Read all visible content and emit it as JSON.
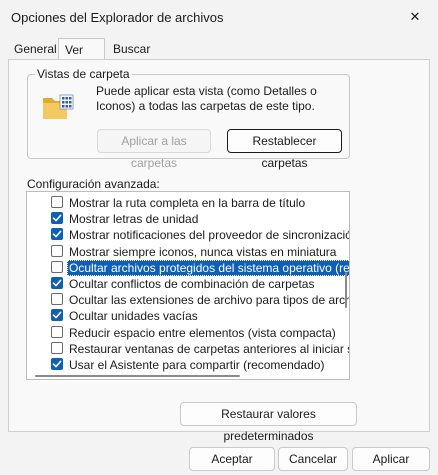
{
  "window": {
    "title": "Opciones del Explorador de archivos",
    "close_glyph": "✕"
  },
  "tabs": [
    {
      "label": "General",
      "active": false
    },
    {
      "label": "Ver",
      "active": true
    },
    {
      "label": "Buscar",
      "active": false
    }
  ],
  "folder_views": {
    "group_label": "Vistas de carpeta",
    "description": "Puede aplicar esta vista (como Detalles o Iconos) a todas las carpetas de este tipo.",
    "apply_label": "Aplicar a las carpetas",
    "reset_label": "Restablecer carpetas"
  },
  "advanced": {
    "label": "Configuración avanzada:",
    "items": [
      {
        "label": "Mostrar la ruta completa en la barra de título",
        "checked": false
      },
      {
        "label": "Mostrar letras de unidad",
        "checked": true
      },
      {
        "label": "Mostrar notificaciones del proveedor de sincronización",
        "checked": true
      },
      {
        "label": "Mostrar siempre iconos, nunca vistas en miniatura",
        "checked": false
      },
      {
        "label": "Ocultar archivos protegidos del sistema operativo (recome",
        "checked": false,
        "selected": true
      },
      {
        "label": "Ocultar conflictos de combinación de carpetas",
        "checked": true
      },
      {
        "label": "Ocultar las extensiones de archivo para tipos de archivo c",
        "checked": false
      },
      {
        "label": "Ocultar unidades vacías",
        "checked": true
      },
      {
        "label": "Reducir espacio entre elementos (vista compacta)",
        "checked": false
      },
      {
        "label": "Restaurar ventanas de carpetas anteriores al iniciar sesió",
        "checked": false
      },
      {
        "label": "Usar el Asistente para compartir (recomendado)",
        "checked": true
      }
    ]
  },
  "restore_defaults_label": "Restaurar valores predeterminados",
  "footer": {
    "ok": "Aceptar",
    "cancel": "Cancelar",
    "apply": "Aplicar"
  },
  "colors": {
    "accent": "#0f5fb5",
    "folder": "#f1c65a"
  }
}
